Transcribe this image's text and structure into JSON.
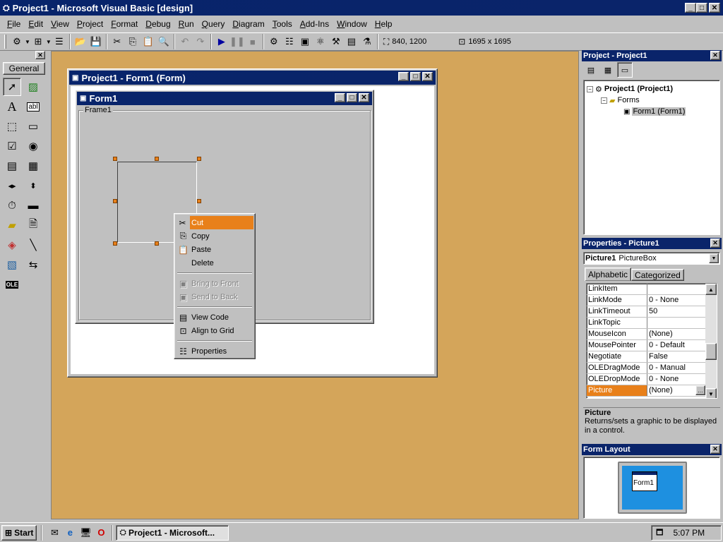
{
  "app": {
    "title": "Project1 - Microsoft Visual Basic [design]"
  },
  "menu": [
    "File",
    "Edit",
    "View",
    "Project",
    "Format",
    "Debug",
    "Run",
    "Query",
    "Diagram",
    "Tools",
    "Add-Ins",
    "Window",
    "Help"
  ],
  "toolbar": {
    "position": "840, 1200",
    "size": "1695 x 1695"
  },
  "toolbox": {
    "title": "General"
  },
  "designer": {
    "title": "Project1 - Form1 (Form)",
    "form_title": "Form1",
    "frame_label": "Frame1"
  },
  "context_menu": {
    "items": [
      {
        "label": "Cut",
        "underline": "t",
        "enabled": true,
        "highlighted": true
      },
      {
        "label": "Copy",
        "enabled": true
      },
      {
        "label": "Paste",
        "enabled": true
      },
      {
        "label": "Delete",
        "enabled": true
      },
      {
        "label": "Bring to Front",
        "enabled": false
      },
      {
        "label": "Send to Back",
        "enabled": false
      },
      {
        "label": "View Code",
        "enabled": true
      },
      {
        "label": "Align to Grid",
        "enabled": true
      },
      {
        "label": "Properties",
        "enabled": true
      }
    ]
  },
  "project_explorer": {
    "title": "Project - Project1",
    "root": "Project1 (Project1)",
    "folder": "Forms",
    "item": "Form1 (Form1)"
  },
  "properties": {
    "title": "Properties - Picture1",
    "object_name": "Picture1",
    "object_type": "PictureBox",
    "tab_alphabetic": "Alphabetic",
    "tab_categorized": "Categorized",
    "rows": [
      {
        "name": "LinkItem",
        "value": ""
      },
      {
        "name": "LinkMode",
        "value": "0 - None"
      },
      {
        "name": "LinkTimeout",
        "value": "50"
      },
      {
        "name": "LinkTopic",
        "value": ""
      },
      {
        "name": "MouseIcon",
        "value": "(None)"
      },
      {
        "name": "MousePointer",
        "value": "0 - Default"
      },
      {
        "name": "Negotiate",
        "value": "False"
      },
      {
        "name": "OLEDragMode",
        "value": "0 - Manual"
      },
      {
        "name": "OLEDropMode",
        "value": "0 - None"
      },
      {
        "name": "Picture",
        "value": "(None)"
      }
    ],
    "selected_row": "Picture",
    "desc_title": "Picture",
    "desc_text": "Returns/sets a graphic to be displayed in a control."
  },
  "form_layout": {
    "title": "Form Layout",
    "form_label": "Form1"
  },
  "taskbar": {
    "start": "Start",
    "task": "Project1 - Microsoft...",
    "time": "5:07 PM"
  },
  "colors": {
    "workspace": "#d4a55a",
    "titlebar": "#0a246a",
    "highlight": "#e8801a"
  }
}
